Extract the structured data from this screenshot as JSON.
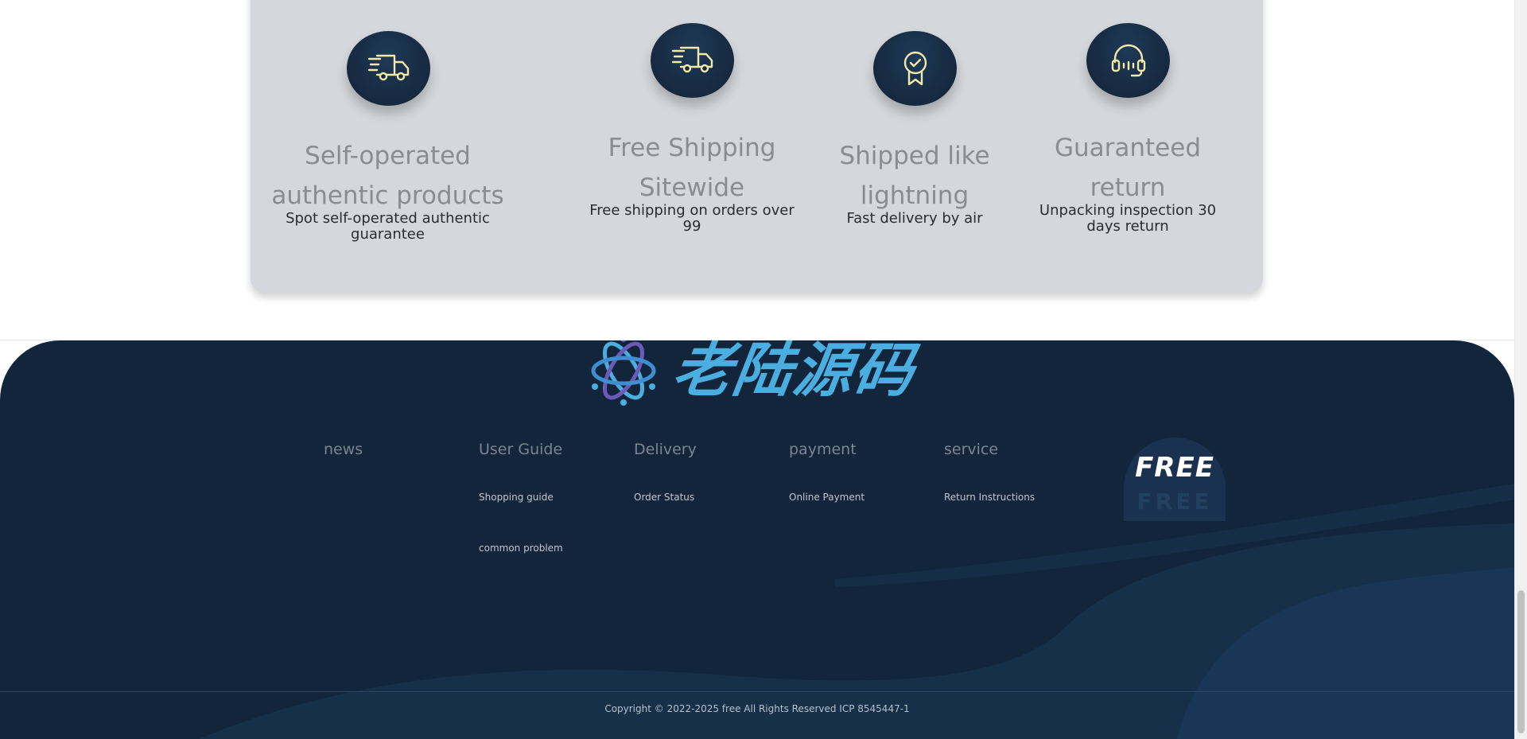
{
  "features": [
    {
      "icon": "delivery-truck-icon",
      "title": "Self-operated authentic products",
      "description": "Spot self-operated authentic guarantee"
    },
    {
      "icon": "fast-delivery-truck-icon",
      "title": "Free Shipping Sitewide",
      "description": "Free shipping on orders over 99"
    },
    {
      "icon": "award-badge-icon",
      "title": "Shipped like lightning",
      "description": "Fast delivery by air"
    },
    {
      "icon": "headset-icon",
      "title": "Guaranteed return",
      "description": "Unpacking inspection 30 days return"
    }
  ],
  "footer": {
    "brand_text": "老陆源码",
    "nav": [
      {
        "heading": "news",
        "links": []
      },
      {
        "heading": "User Guide",
        "links": [
          "Shopping guide",
          "common problem"
        ]
      },
      {
        "heading": "Delivery",
        "links": [
          "Order Status"
        ]
      },
      {
        "heading": "payment",
        "links": [
          "Online Payment"
        ]
      },
      {
        "heading": "service",
        "links": [
          "Return Instructions"
        ]
      }
    ],
    "badge_text": "FREE",
    "badge_shadow_text": "FREE",
    "copyright": "Copyright © 2022-2025 free All Rights Reserved ICP 8545447-1"
  },
  "colors": {
    "card_background": "#d4d7db",
    "icon_circle": "#16293f",
    "icon_stroke": "#f3e9a8",
    "footer_background": "#13253a",
    "brand_blue": "#4aaee0"
  }
}
